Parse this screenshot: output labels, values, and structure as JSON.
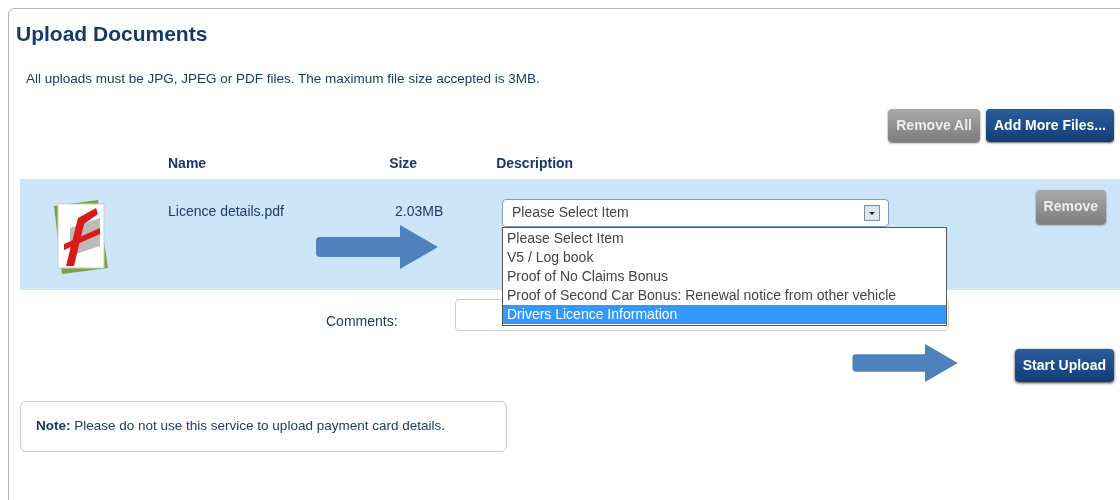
{
  "title": "Upload Documents",
  "intro": "All uploads must be JPG, JPEG or PDF files. The maximum file size accepted is 3MB.",
  "toolbar": [
    {
      "label": "Remove All",
      "kind": "secondary"
    },
    {
      "label": "Add More Files...",
      "kind": "primary"
    }
  ],
  "columns": [
    "Name",
    "Size",
    "Description"
  ],
  "files": [
    {
      "name": "Licence details.pdf",
      "size": "2.03MB",
      "description": {
        "value": "Please Select Item",
        "expanded": true,
        "options": [
          {
            "label": "Please Select Item",
            "highlighted": false
          },
          {
            "label": "V5 / Log book",
            "highlighted": false
          },
          {
            "label": "Proof of No Claims Bonus",
            "highlighted": false
          },
          {
            "label": "Proof of Second Car Bonus: Renewal notice from other vehicle",
            "highlighted": false
          },
          {
            "label": "Drivers Licence Information",
            "highlighted": true
          }
        ]
      },
      "remove": "Remove"
    }
  ],
  "comments": {
    "label": "Comments:"
  },
  "submit": "Start Upload",
  "note": "**Note:** Please do not use this service to upload payment card details."
}
